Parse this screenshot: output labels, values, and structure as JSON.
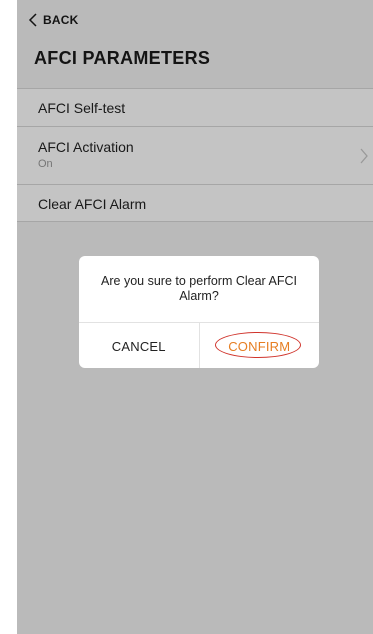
{
  "nav": {
    "back_label": "BACK",
    "back_icon": "chevron-left-icon"
  },
  "page": {
    "title": "AFCI PARAMETERS"
  },
  "list": {
    "items": [
      {
        "label": "AFCI Self-test"
      },
      {
        "label": "AFCI Activation",
        "sub": "On",
        "icon": "chevron-right-icon"
      },
      {
        "label": "Clear AFCI Alarm"
      }
    ]
  },
  "dialog": {
    "message": "Are you sure to perform Clear AFCI Alarm?",
    "cancel_label": "CANCEL",
    "confirm_label": "CONFIRM"
  },
  "colors": {
    "confirm_text": "#e67e22",
    "highlight_ring": "#d0342c",
    "background": "#f2f2f2"
  }
}
